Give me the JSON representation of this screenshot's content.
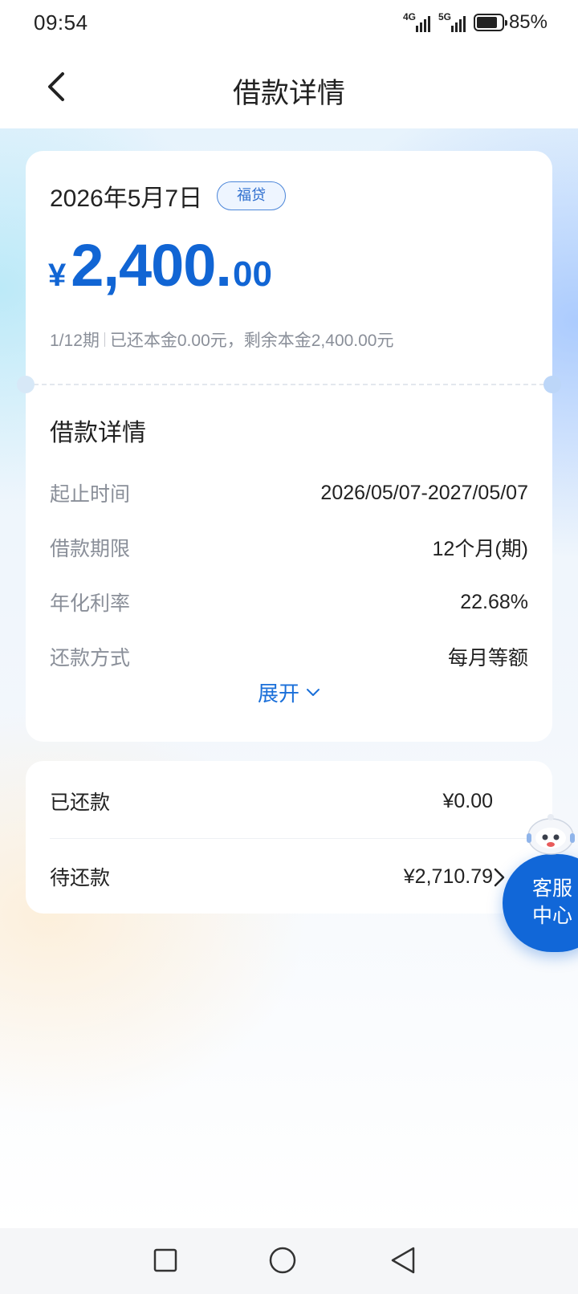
{
  "status_bar": {
    "time": "09:54",
    "network_1": "4G",
    "network_2": "5G",
    "battery_percent": "85%",
    "battery_level": 0.85
  },
  "header": {
    "title": "借款详情",
    "back_icon": "chevron-left-icon"
  },
  "loan": {
    "date": "2026年5月7日",
    "tag": "福贷",
    "currency_symbol": "¥",
    "amount_integer": "2,400.",
    "amount_decimal": "00",
    "installment": "1/12期",
    "principal_info": "已还本金0.00元，剩余本金2,400.00元",
    "section_title": "借款详情",
    "rows": [
      {
        "label": "起止时间",
        "value": "2026/05/07-2027/05/07"
      },
      {
        "label": "借款期限",
        "value": "12个月(期)"
      },
      {
        "label": "年化利率",
        "value": "22.68%"
      },
      {
        "label": "还款方式",
        "value": "每月等额"
      }
    ],
    "expand_label": "展开"
  },
  "repayment": {
    "paid_label": "已还款",
    "paid_amount": "¥0.00",
    "pending_label": "待还款",
    "pending_amount": "¥2,710.79"
  },
  "customer_service": {
    "label_line1": "客服",
    "label_line2": "中心"
  },
  "colors": {
    "accent": "#1165d4",
    "text_primary": "#222222",
    "text_secondary": "#8a8f99"
  }
}
